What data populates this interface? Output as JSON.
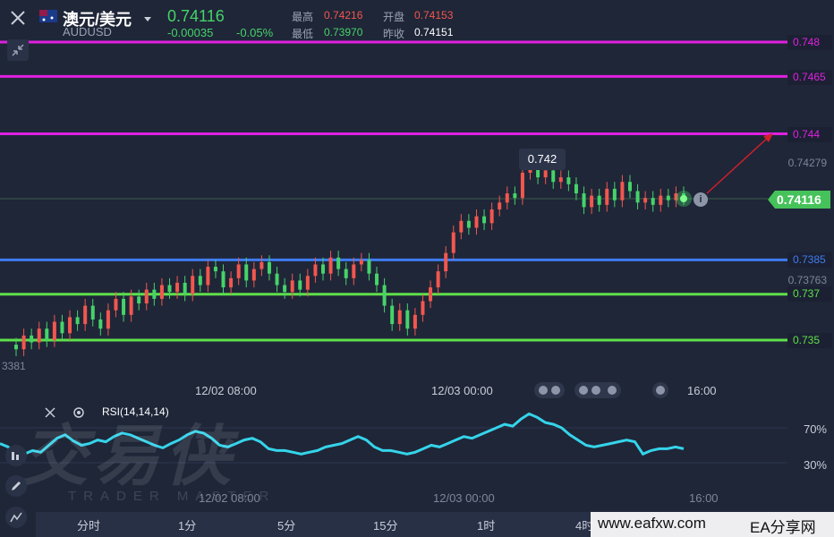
{
  "header": {
    "pair_name": "澳元/美元",
    "symbol": "AUDUSD",
    "price": "0.74116",
    "change": "-0.00035",
    "change_pct": "-0.05%",
    "stats": {
      "high_label": "最高",
      "high": "0.74216",
      "open_label": "开盘",
      "open": "0.74153",
      "low_label": "最低",
      "low": "0.73970",
      "prev_close_label": "昨收",
      "prev_close": "0.74151"
    }
  },
  "price_axis": {
    "current_price": "0.74116",
    "price_tags": [
      "0.74279",
      "0.73763",
      "3381"
    ]
  },
  "level_lines": [
    {
      "label": "0.748",
      "color": "#e020e0"
    },
    {
      "label": "0.7465",
      "color": "#e020e0"
    },
    {
      "label": "0.744",
      "color": "#e020e0"
    },
    {
      "label": "0.7385",
      "color": "#3f7cf0"
    },
    {
      "label": "0.737",
      "color": "#5fe04a"
    },
    {
      "label": "0.735",
      "color": "#5fe04a"
    }
  ],
  "annotation": {
    "label": "0.742"
  },
  "time_axis": [
    "12/02 08:00",
    "12/03 00:00",
    "16:00"
  ],
  "rsi": {
    "label": "RSI(14,14,14)",
    "levels": [
      "70%",
      "30%"
    ],
    "time_axis": [
      "12/02 08:00",
      "12/03 00:00",
      "16:00"
    ]
  },
  "timeframes": [
    "分时",
    "1分",
    "5分",
    "15分",
    "1时",
    "4时"
  ],
  "watermark": {
    "text": "交易侠",
    "sub": "TRADER MASTER"
  },
  "footer": {
    "site": "www.eafxw.com",
    "brand": "EA分享网"
  },
  "colors": {
    "up": "#f2574e",
    "down": "#46d369",
    "rsi": "#35d4ea",
    "bg": "#1f2638"
  }
}
